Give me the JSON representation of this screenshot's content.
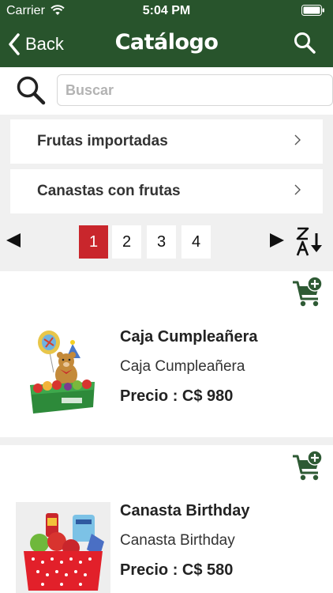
{
  "status_bar": {
    "carrier": "Carrier",
    "time": "5:04 PM"
  },
  "nav": {
    "back_label": "Back",
    "title": "Catálogo"
  },
  "search": {
    "placeholder": "Buscar",
    "value": ""
  },
  "categories": [
    {
      "label": "Frutas importadas"
    },
    {
      "label": "Canastas con frutas"
    }
  ],
  "pagination": {
    "pages": [
      "1",
      "2",
      "3",
      "4"
    ],
    "current": "1"
  },
  "products": [
    {
      "title": "Caja Cumpleañera",
      "subtitle": "Caja Cumpleañera",
      "price": "Precio : C$ 980"
    },
    {
      "title": "Canasta Birthday",
      "subtitle": "Canasta Birthday",
      "price": "Precio : C$ 580"
    }
  ],
  "colors": {
    "header": "#28542c",
    "accent": "#c9262c",
    "cart_icon": "#2e5a34"
  },
  "icons": [
    "wifi-icon",
    "battery-icon",
    "chevron-left-icon",
    "search-icon",
    "chevron-right-icon",
    "triangle-left-icon",
    "triangle-right-icon",
    "sort-z-a-icon",
    "add-to-cart-icon"
  ]
}
